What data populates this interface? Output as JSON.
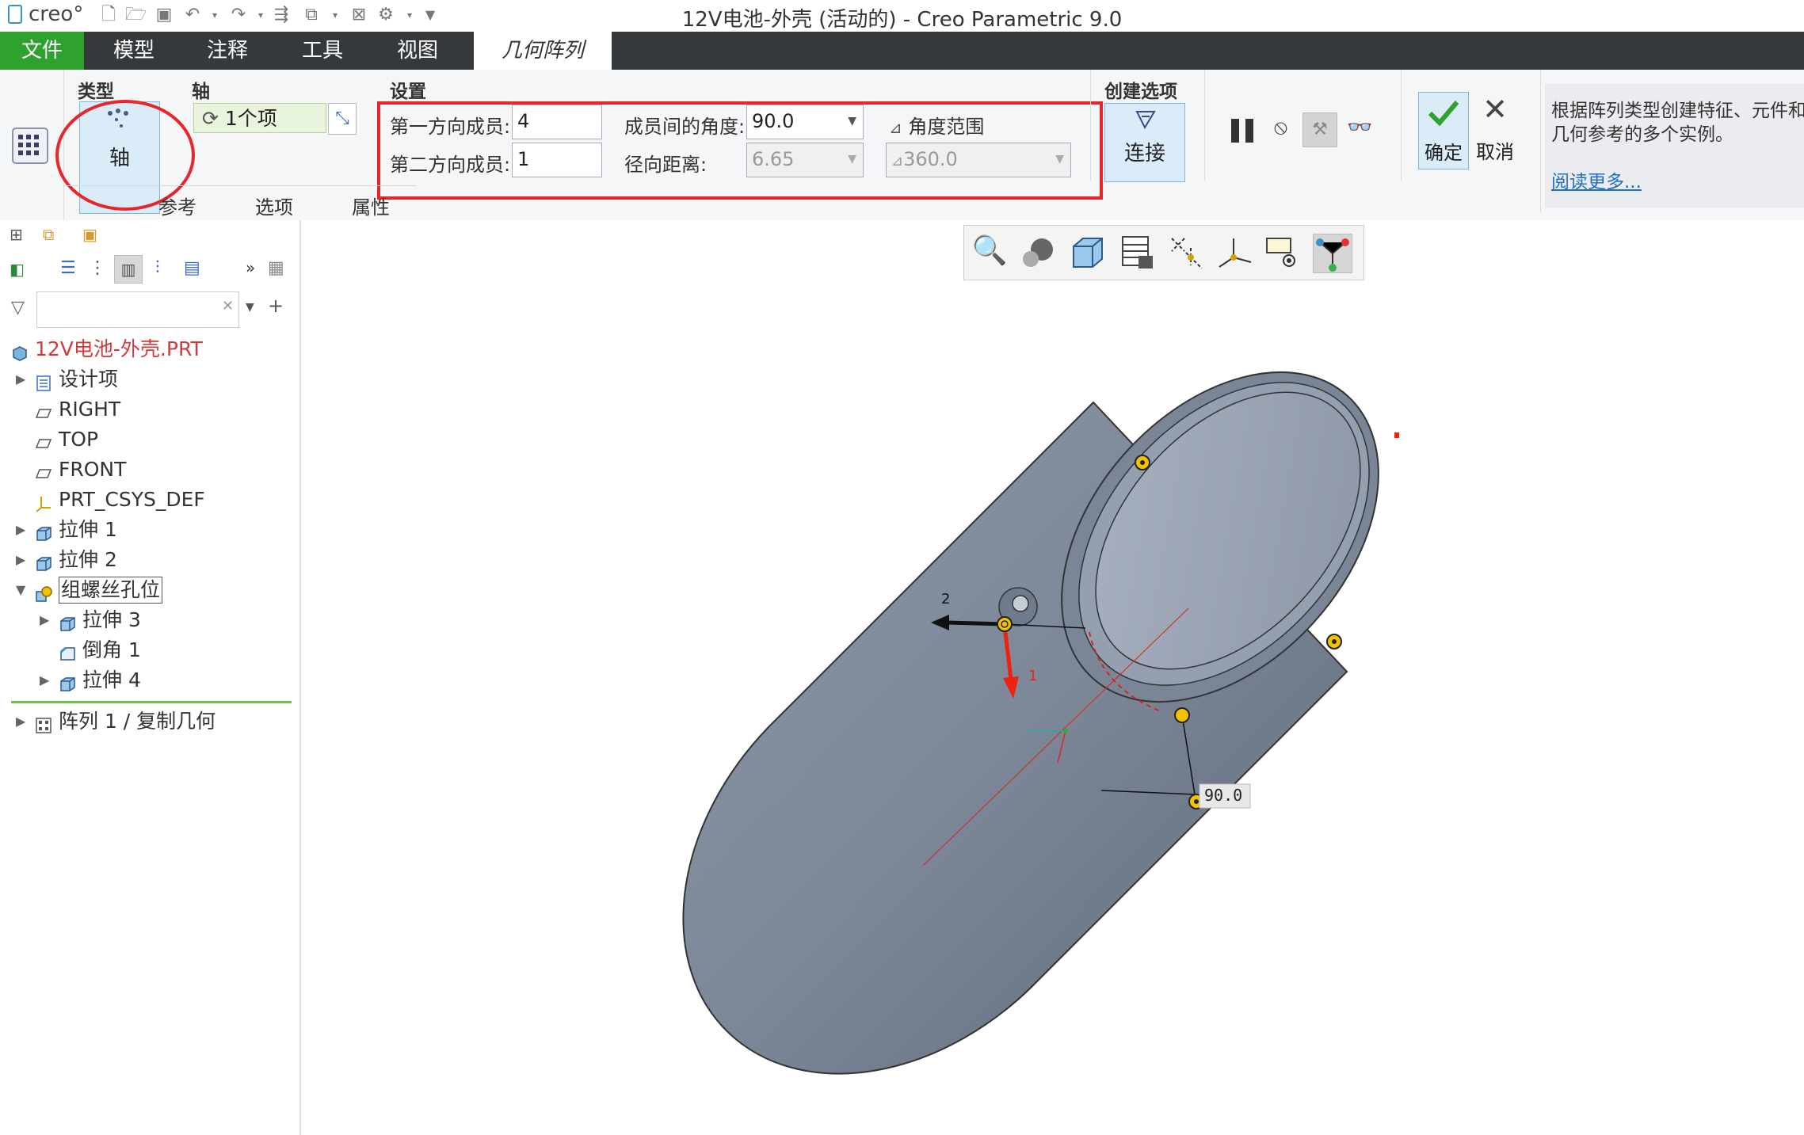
{
  "title_bar": {
    "logo": "creo°",
    "title": "12V电池-外壳 (活动的) - Creo Parametric 9.0"
  },
  "menu": {
    "tabs": [
      "文件",
      "模型",
      "注释",
      "工具",
      "视图",
      "几何阵列"
    ]
  },
  "ribbon": {
    "type_group": {
      "label": "类型",
      "button": "轴"
    },
    "axis_group": {
      "label": "轴",
      "collector": "1个项"
    },
    "settings": {
      "label": "设置",
      "first_members_label": "第一方向成员:",
      "first_members_value": "4",
      "second_members_label": "第二方向成员:",
      "second_members_value": "1",
      "angle_label": "成员间的角度:",
      "angle_value": "90.0",
      "radial_label": "径向距离:",
      "radial_value": "6.65",
      "angle_range_label": "角度范围",
      "angle_range_value": "360.0"
    },
    "create_options": {
      "label": "创建选项",
      "button": "连接"
    },
    "ok_label": "确定",
    "cancel_label": "取消",
    "sub_tabs": [
      "参考",
      "选项",
      "属性"
    ],
    "help": {
      "text_line1": "根据阵列类型创建特征、元件和",
      "text_line2": "几何参考的多个实例。",
      "link": "阅读更多..."
    },
    "colors": {
      "highlight": "#e8262a",
      "accent": "#2ea12e",
      "menubar": "#36393c"
    }
  },
  "tree": {
    "items": [
      {
        "label": "12V电池-外壳.PRT",
        "icon": "part-icon",
        "level": 0,
        "expand": ""
      },
      {
        "label": "设计项",
        "icon": "design-items-icon",
        "level": 1,
        "expand": "▶"
      },
      {
        "label": "RIGHT",
        "icon": "datum-plane-icon",
        "level": 1,
        "expand": ""
      },
      {
        "label": "TOP",
        "icon": "datum-plane-icon",
        "level": 1,
        "expand": ""
      },
      {
        "label": "FRONT",
        "icon": "datum-plane-icon",
        "level": 1,
        "expand": ""
      },
      {
        "label": "PRT_CSYS_DEF",
        "icon": "csys-icon",
        "level": 1,
        "expand": ""
      },
      {
        "label": "拉伸 1",
        "icon": "extrude-icon",
        "level": 1,
        "expand": "▶"
      },
      {
        "label": "拉伸 2",
        "icon": "extrude-icon",
        "level": 1,
        "expand": "▶"
      },
      {
        "label": "组螺丝孔位",
        "icon": "group-icon",
        "level": 1,
        "expand": "▼"
      },
      {
        "label": "拉伸 3",
        "icon": "extrude-icon",
        "level": 2,
        "expand": "▶"
      },
      {
        "label": "倒角 1",
        "icon": "chamfer-icon",
        "level": 2,
        "expand": ""
      },
      {
        "label": "拉伸 4",
        "icon": "extrude-icon",
        "level": 2,
        "expand": "▶"
      },
      {
        "label": "阵列 1 / 复制几何",
        "icon": "pattern-icon",
        "level": 1,
        "expand": "▶"
      }
    ]
  },
  "graphics": {
    "angle_dim": "90.0",
    "dir1_label": "1",
    "dir2_label": "2"
  }
}
